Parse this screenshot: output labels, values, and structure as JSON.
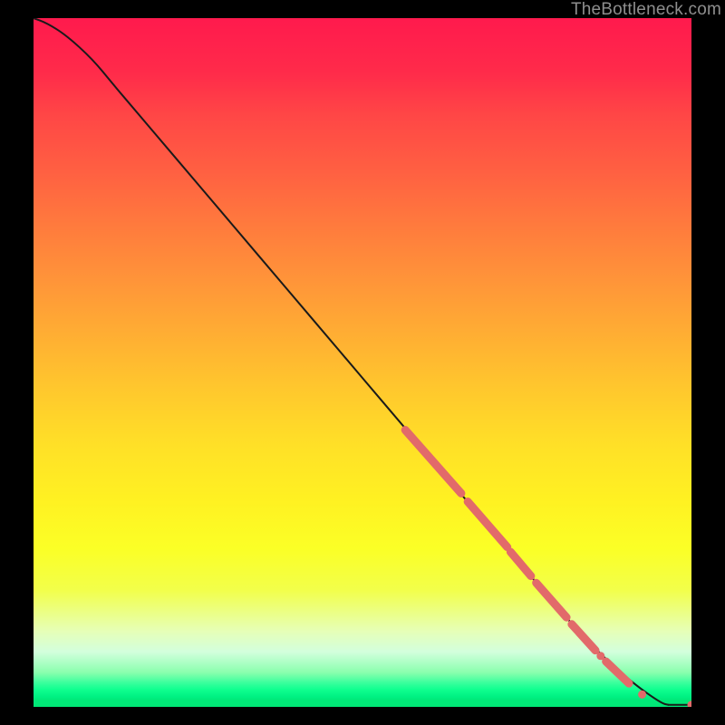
{
  "watermark": "TheBottleneck.com",
  "chart_data": {
    "type": "line",
    "title": "",
    "xlabel": "",
    "ylabel": "",
    "xlim": [
      0,
      1
    ],
    "ylim": [
      0,
      1
    ],
    "curve": [
      {
        "x": 0.0,
        "y": 1.0
      },
      {
        "x": 0.02,
        "y": 0.993
      },
      {
        "x": 0.05,
        "y": 0.975
      },
      {
        "x": 0.09,
        "y": 0.94
      },
      {
        "x": 0.12,
        "y": 0.905
      },
      {
        "x": 0.16,
        "y": 0.86
      },
      {
        "x": 0.2,
        "y": 0.815
      },
      {
        "x": 0.24,
        "y": 0.77
      },
      {
        "x": 0.28,
        "y": 0.725
      },
      {
        "x": 0.32,
        "y": 0.68
      },
      {
        "x": 0.36,
        "y": 0.635
      },
      {
        "x": 0.4,
        "y": 0.59
      },
      {
        "x": 0.44,
        "y": 0.545
      },
      {
        "x": 0.48,
        "y": 0.5
      },
      {
        "x": 0.52,
        "y": 0.455
      },
      {
        "x": 0.56,
        "y": 0.41
      },
      {
        "x": 0.6,
        "y": 0.365
      },
      {
        "x": 0.64,
        "y": 0.32
      },
      {
        "x": 0.68,
        "y": 0.275
      },
      {
        "x": 0.72,
        "y": 0.23
      },
      {
        "x": 0.76,
        "y": 0.185
      },
      {
        "x": 0.8,
        "y": 0.14
      },
      {
        "x": 0.84,
        "y": 0.098
      },
      {
        "x": 0.88,
        "y": 0.06
      },
      {
        "x": 0.92,
        "y": 0.028
      },
      {
        "x": 0.955,
        "y": 0.005
      },
      {
        "x": 0.965,
        "y": 0.003
      }
    ],
    "flat_tail": [
      {
        "x": 0.965,
        "y": 0.003
      },
      {
        "x": 1.0,
        "y": 0.003
      }
    ],
    "highlight_segments": [
      {
        "x1": 0.565,
        "y1": 0.402,
        "x2": 0.65,
        "y2": 0.31
      },
      {
        "x1": 0.66,
        "y1": 0.298,
        "x2": 0.72,
        "y2": 0.232
      },
      {
        "x1": 0.725,
        "y1": 0.225,
        "x2": 0.756,
        "y2": 0.19
      },
      {
        "x1": 0.764,
        "y1": 0.18,
        "x2": 0.81,
        "y2": 0.13
      },
      {
        "x1": 0.818,
        "y1": 0.12,
        "x2": 0.854,
        "y2": 0.082
      },
      {
        "x1": 0.87,
        "y1": 0.066,
        "x2": 0.905,
        "y2": 0.034
      }
    ],
    "highlight_dots": [
      {
        "x": 0.862,
        "y": 0.074
      },
      {
        "x": 0.925,
        "y": 0.018
      },
      {
        "x": 1.0,
        "y": 0.003
      }
    ],
    "dot_radius_px": 4.5,
    "notes": "axes have no visible numeric labels; coordinates are unitless 0–1"
  },
  "colors": {
    "highlight": "#e26a6a",
    "curve": "#1a1a1a",
    "watermark": "#8e8e8e"
  }
}
